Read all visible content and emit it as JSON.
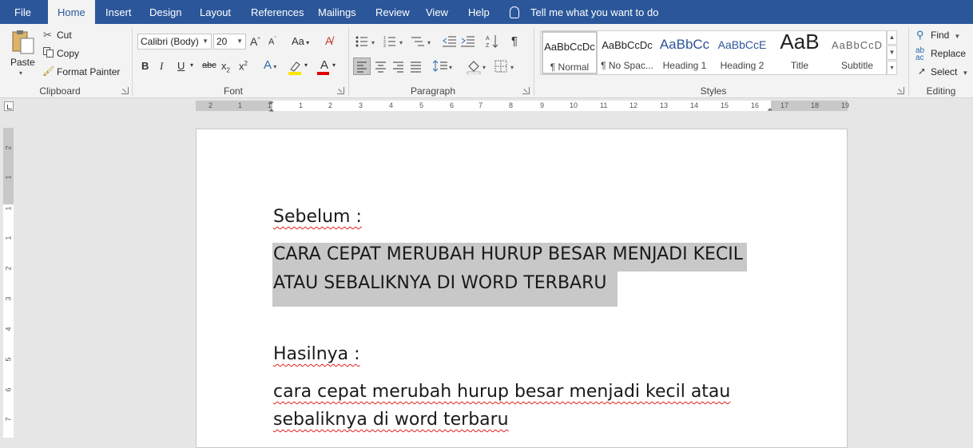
{
  "tabs": [
    "File",
    "Home",
    "Insert",
    "Design",
    "Layout",
    "References",
    "Mailings",
    "Review",
    "View",
    "Help"
  ],
  "active_tab": "Home",
  "tell_me": "Tell me what you want to do",
  "clipboard": {
    "paste": "Paste",
    "cut": "Cut",
    "copy": "Copy",
    "format_painter": "Format Painter",
    "label": "Clipboard"
  },
  "font": {
    "name": "Calibri (Body)",
    "size": "20",
    "label": "Font"
  },
  "paragraph": {
    "label": "Paragraph"
  },
  "styles": {
    "label": "Styles",
    "items": [
      {
        "preview": "AaBbCcDc",
        "name": "¶ Normal"
      },
      {
        "preview": "AaBbCcDc",
        "name": "¶ No Spac..."
      },
      {
        "preview": "AaBbCc",
        "name": "Heading 1"
      },
      {
        "preview": "AaBbCcE",
        "name": "Heading 2"
      },
      {
        "preview": "AaB",
        "name": "Title"
      },
      {
        "preview": "AaBbCcD",
        "name": "Subtitle"
      }
    ]
  },
  "editing": {
    "find": "Find",
    "replace": "Replace",
    "select": "Select",
    "label": "Editing"
  },
  "ruler": {
    "numbers": [
      "2",
      "1",
      "1",
      "1",
      "2",
      "3",
      "4",
      "5",
      "6",
      "7",
      "8",
      "9",
      "10",
      "11",
      "12",
      "13",
      "14",
      "15",
      "16",
      "17",
      "18",
      "19"
    ],
    "vnumbers": [
      "2",
      "1",
      "1",
      "1",
      "2",
      "3",
      "4",
      "5",
      "6",
      "7"
    ]
  },
  "document": {
    "heading1": "Sebelum :",
    "line1": "CARA CEPAT MERUBAH HURUP BESAR MENJADI KECIL",
    "line2": "ATAU SEBALIKNYA DI WORD TERBARU",
    "heading2": "Hasilnya :",
    "line3": "cara cepat merubah hurup besar menjadi kecil atau",
    "line4": "sebaliknya di word terbaru"
  },
  "colors": {
    "brand": "#2b579a",
    "highlight": "#c8c8c8",
    "spell": "#e02020"
  }
}
